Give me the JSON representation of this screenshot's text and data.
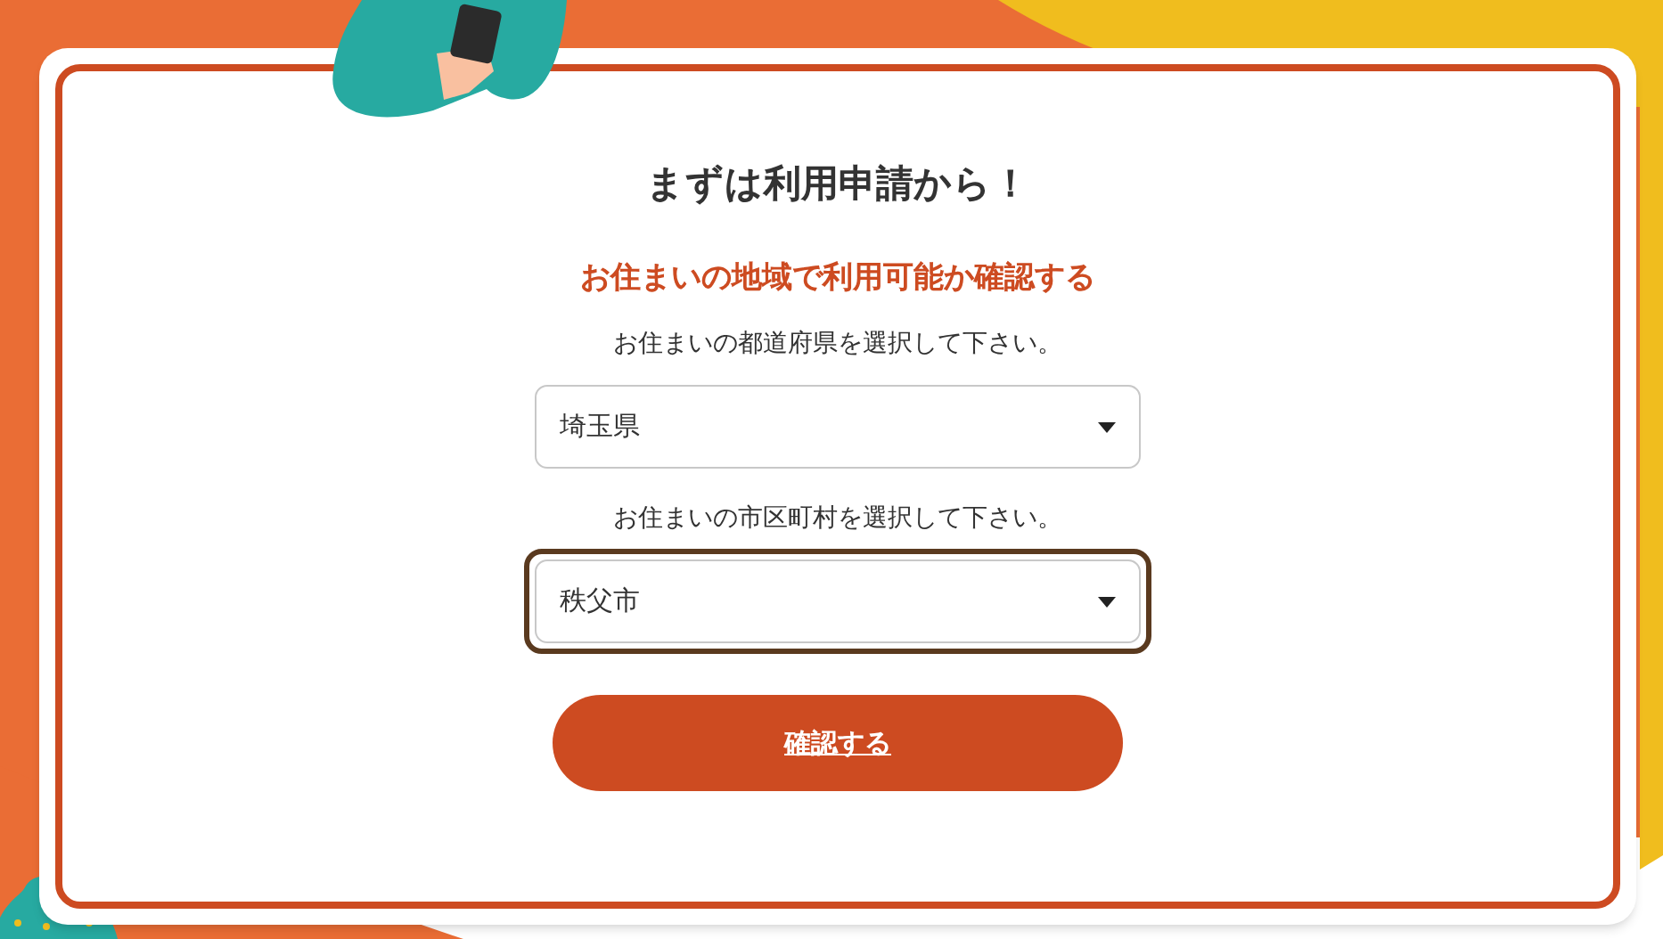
{
  "heading": "まずは利用申請から！",
  "subheading": "お住まいの地域で利用可能か確認する",
  "selects": [
    {
      "label": "お住まいの都道府県を選択して下さい。",
      "value": "埼玉県",
      "focused": false
    },
    {
      "label": "お住まいの市区町村を選択して下さい。",
      "value": "秩父市",
      "focused": true
    }
  ],
  "button": "確認する"
}
